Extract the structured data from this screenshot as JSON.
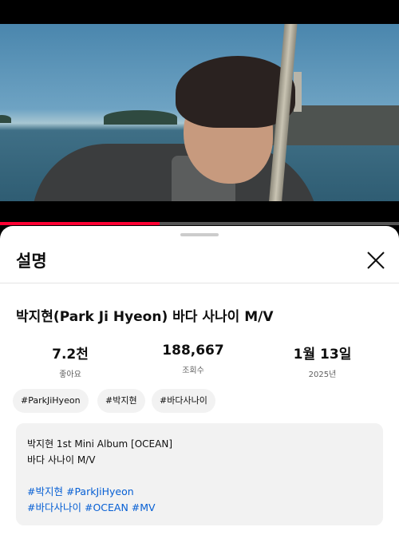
{
  "player": {
    "progress_fraction": 0.4
  },
  "sheet": {
    "title": "설명",
    "close_icon": "close-icon"
  },
  "video": {
    "title": "박지현(Park Ji Hyeon) 바다 사나이 M/V"
  },
  "stats": [
    {
      "value": "7.2천",
      "label": "좋아요"
    },
    {
      "value": "188,667",
      "label": "조회수"
    },
    {
      "value": "1월 13일",
      "label": "2025년"
    }
  ],
  "chips": [
    "#ParkJiHyeon",
    "#박지현",
    "#바다사나이"
  ],
  "description": {
    "line1": "박지현 1st Mini Album [OCEAN]",
    "line2": "바다 사나이 M/V",
    "tags_line1": [
      "#박지현",
      "#ParkJiHyeon"
    ],
    "tags_line2": [
      "#바다사나이",
      "#OCEAN",
      "#MV"
    ]
  },
  "colors": {
    "progress": "#ff0033",
    "hashtag": "#065fd4"
  }
}
